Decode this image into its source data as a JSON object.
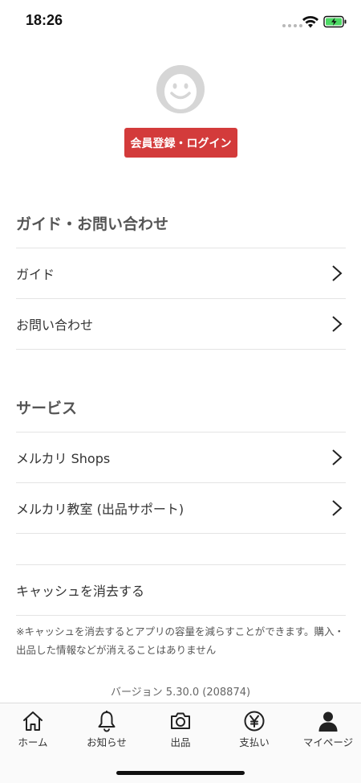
{
  "status_bar": {
    "time": "18:26"
  },
  "profile": {
    "login_label": "会員登録・ログイン"
  },
  "sections": {
    "guide": {
      "header": "ガイド・お問い合わせ",
      "items": [
        {
          "label": "ガイド"
        },
        {
          "label": "お問い合わせ"
        }
      ]
    },
    "services": {
      "header": "サービス",
      "items": [
        {
          "label": "メルカリ Shops"
        },
        {
          "label": "メルカリ教室 (出品サポート)"
        }
      ]
    }
  },
  "cache": {
    "clear_label": "キャッシュを消去する",
    "note": "※キャッシュを消去するとアプリの容量を減らすことができます。購入・出品した情報などが消えることはありません"
  },
  "version": "バージョン 5.30.0 (208874)",
  "tab_bar": {
    "tabs": [
      {
        "label": "ホーム",
        "icon": "home-icon"
      },
      {
        "label": "お知らせ",
        "icon": "bell-icon"
      },
      {
        "label": "出品",
        "icon": "camera-icon"
      },
      {
        "label": "支払い",
        "icon": "yen-icon"
      },
      {
        "label": "マイページ",
        "icon": "person-icon"
      }
    ]
  },
  "colors": {
    "accent": "#d33b3b",
    "battery": "#4cd964"
  }
}
